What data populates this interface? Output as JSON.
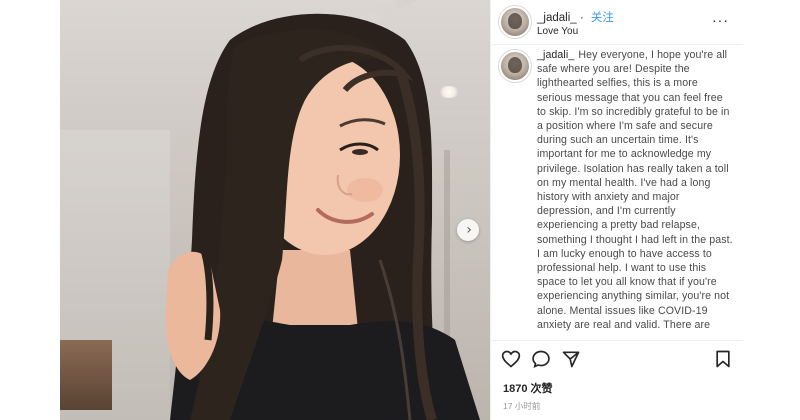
{
  "post": {
    "username": "_jadali_",
    "follow_label": "关注",
    "subtitle": "Love You",
    "more_label": "···",
    "caption_username": "_jadali_",
    "caption_text": "Hey everyone, I hope you're all safe where you are! Despite the lighthearted selfies, this is a more serious message that you can feel free to skip. I'm so incredibly grateful to be in a position where I'm safe and secure during such an uncertain time. It's important for me to acknowledge my privilege. Isolation has really taken a toll on my mental health. I've had a long history with anxiety and major depression, and I'm currently experiencing a pretty bad relapse, something I thought I had left in the past. I am lucky enough to have access to professional help. I want to use this space to let you all know that if you're experiencing anything similar, you're not alone.",
    "caption_highlight": "Mental issues like COVID-19",
    "caption_tail": "anxiety are real and valid. There are",
    "likes": "1870 次赞",
    "time": "17 小时前"
  },
  "colors": {
    "follow": "#3897f0",
    "underline": "#d9321e",
    "text": "#262626"
  },
  "icons": [
    "more-icon",
    "carousel-next-icon",
    "heart-icon",
    "comment-icon",
    "share-icon",
    "bookmark-icon"
  ]
}
